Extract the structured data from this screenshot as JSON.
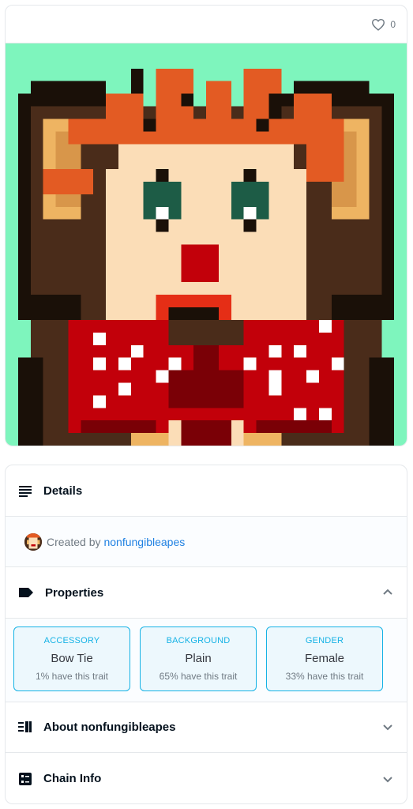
{
  "favorite": {
    "icon": "heart-icon",
    "count": "0"
  },
  "artwork": {
    "description": "pixel-art ape",
    "colors": {
      "background": "#7ef5bd",
      "outline": "#1a1008",
      "fur": "#4a2c1a",
      "face": "#fbddb7",
      "ear": "#eeb462",
      "hair": "#e35b23",
      "eye_green": "#1d5c46",
      "nose": "#c2000a",
      "mouth": "#e52e16",
      "bow": "#c2000a",
      "bow_dark": "#7a0006",
      "dots": "#ffffff",
      "chest": "#eeb462"
    }
  },
  "details": {
    "icon": "list-icon",
    "title": "Details"
  },
  "created": {
    "prefix": "Created by",
    "creator": "nonfungibleapes"
  },
  "properties": {
    "icon": "tag-icon",
    "title": "Properties",
    "chevron": "chevron-up-icon",
    "traits": [
      {
        "type": "ACCESSORY",
        "value": "Bow Tie",
        "rarity": "1% have this trait"
      },
      {
        "type": "BACKGROUND",
        "value": "Plain",
        "rarity": "65% have this trait"
      },
      {
        "type": "GENDER",
        "value": "Female",
        "rarity": "33% have this trait"
      }
    ]
  },
  "about": {
    "icon": "about-icon",
    "title": "About nonfungibleapes",
    "chevron": "chevron-down-icon"
  },
  "chain": {
    "icon": "chain-info-icon",
    "title": "Chain Info",
    "chevron": "chevron-down-icon"
  }
}
